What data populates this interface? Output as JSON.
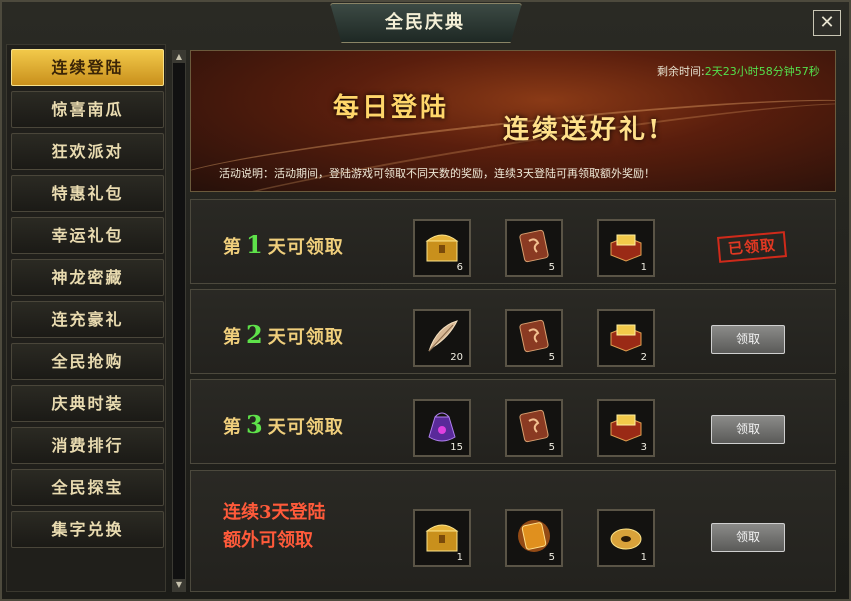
{
  "window": {
    "title": "全民庆典",
    "close_label": "✕"
  },
  "sidebar": {
    "items": [
      {
        "label": "连续登陆",
        "active": true
      },
      {
        "label": "惊喜南瓜"
      },
      {
        "label": "狂欢派对"
      },
      {
        "label": "特惠礼包"
      },
      {
        "label": "幸运礼包"
      },
      {
        "label": "神龙密藏"
      },
      {
        "label": "连充豪礼"
      },
      {
        "label": "全民抢购"
      },
      {
        "label": "庆典时装"
      },
      {
        "label": "消费排行"
      },
      {
        "label": "全民探宝"
      },
      {
        "label": "集字兑换"
      }
    ]
  },
  "banner": {
    "timer_label": "剩余时间:",
    "timer_value": "2天23小时58分钟57秒",
    "title_line1": "每日登陆",
    "title_line2": "连续送好礼!",
    "description": "活动说明：活动期间，登陆游戏可领取不同天数的奖励，连续3天登陆可再领取额外奖励！"
  },
  "rows": [
    {
      "prefix": "第",
      "day": "1",
      "suffix": "天可领取",
      "items": [
        {
          "icon": "golden-chest-icon",
          "count": "6"
        },
        {
          "icon": "rune-scroll-icon",
          "count": "5"
        },
        {
          "icon": "gold-box-icon",
          "count": "1"
        }
      ],
      "status": "已领取"
    },
    {
      "prefix": "第",
      "day": "2",
      "suffix": "天可领取",
      "items": [
        {
          "icon": "feather-icon",
          "count": "20"
        },
        {
          "icon": "rune-scroll-icon",
          "count": "5"
        },
        {
          "icon": "gold-box-icon",
          "count": "2"
        }
      ],
      "button": "领取"
    },
    {
      "prefix": "第",
      "day": "3",
      "suffix": "天可领取",
      "items": [
        {
          "icon": "purple-bag-icon",
          "count": "15"
        },
        {
          "icon": "rune-scroll-icon",
          "count": "5"
        },
        {
          "icon": "gold-box-icon",
          "count": "3"
        }
      ],
      "button": "领取"
    },
    {
      "label_line1": "连续3天登陆",
      "label_line2": "额外可领取",
      "items": [
        {
          "icon": "golden-chest-icon",
          "count": "1"
        },
        {
          "icon": "glowing-rune-icon",
          "count": "5"
        },
        {
          "icon": "gold-coin-icon",
          "count": "1"
        }
      ],
      "button": "领取"
    }
  ],
  "colors": {
    "accent_gold": "#f2c94a",
    "day_number_green": "#5ee24a",
    "bonus_red": "#ff5a3a",
    "timer_green": "#54e04c"
  }
}
